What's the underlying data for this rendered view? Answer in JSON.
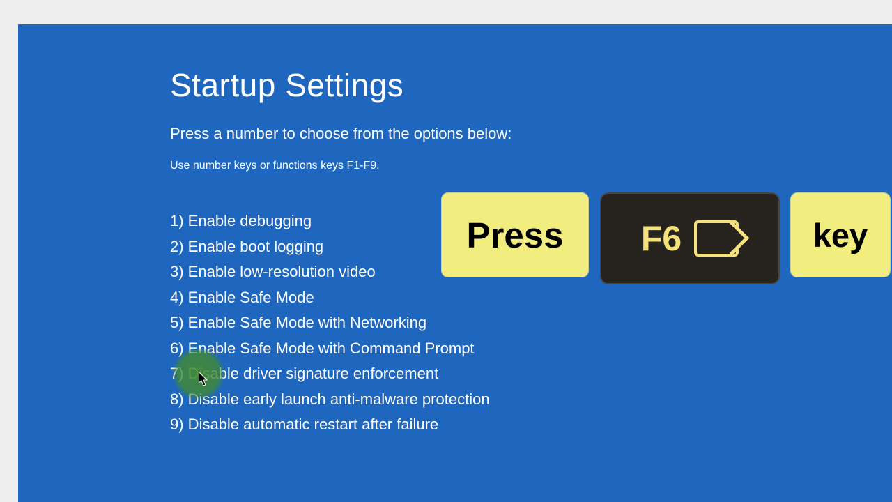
{
  "screen": {
    "title": "Startup Settings",
    "instruction": "Press a number to choose from the options below:",
    "hint": "Use number keys or functions keys F1-F9.",
    "options": [
      "1) Enable debugging",
      "2) Enable boot logging",
      "3) Enable low-resolution video",
      "4) Enable Safe Mode",
      "5) Enable Safe Mode with Networking",
      "6) Enable Safe Mode with Command Prompt",
      "7) Disable driver signature enforcement",
      "8) Disable early launch anti-malware protection",
      "9) Disable automatic restart after failure"
    ]
  },
  "annotation": {
    "press": "Press",
    "key_label": "F6",
    "key": "key"
  },
  "colors": {
    "bg": "#1e66be",
    "card": "#f1ed7f",
    "keycap": "#26231f"
  }
}
